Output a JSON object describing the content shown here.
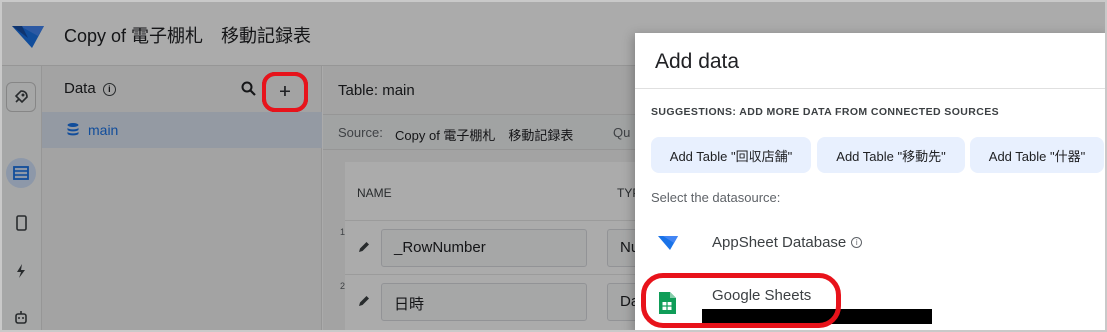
{
  "app": {
    "title": "Copy of 電子棚札　移動記録表"
  },
  "rail": {
    "icons": [
      "rocket-icon",
      "table-icon",
      "phone-icon",
      "bolt-icon",
      "robot-icon"
    ]
  },
  "data_panel": {
    "title": "Data",
    "tables": [
      {
        "label": "main"
      }
    ]
  },
  "main": {
    "table_title": "Table: main",
    "source_label": "Source:",
    "source_value": "Copy of 電子棚札　移動記録表",
    "source_extra": "Qu",
    "columns": {
      "name": "NAME",
      "type": "TYP"
    },
    "rows": [
      {
        "num": "1",
        "name": "_RowNumber",
        "type": "Nu"
      },
      {
        "num": "2",
        "name": "日時",
        "type": "Da"
      }
    ]
  },
  "dialog": {
    "title": "Add data",
    "suggestions_label": "SUGGESTIONS: ADD MORE DATA FROM CONNECTED SOURCES",
    "suggestions": [
      "Add Table \"回収店舗\"",
      "Add Table \"移動先\"",
      "Add Table \"什器\""
    ],
    "select_label": "Select the datasource:",
    "datasources": [
      {
        "label": "AppSheet Database",
        "icon": "appsheet-logo-icon"
      },
      {
        "label": "Google Sheets",
        "icon": "google-sheets-icon"
      }
    ]
  },
  "colors": {
    "accent": "#1a73e8",
    "highlight": "#e8131b",
    "chip_bg": "#e8f0fe",
    "sheets_green": "#0f9d58"
  }
}
